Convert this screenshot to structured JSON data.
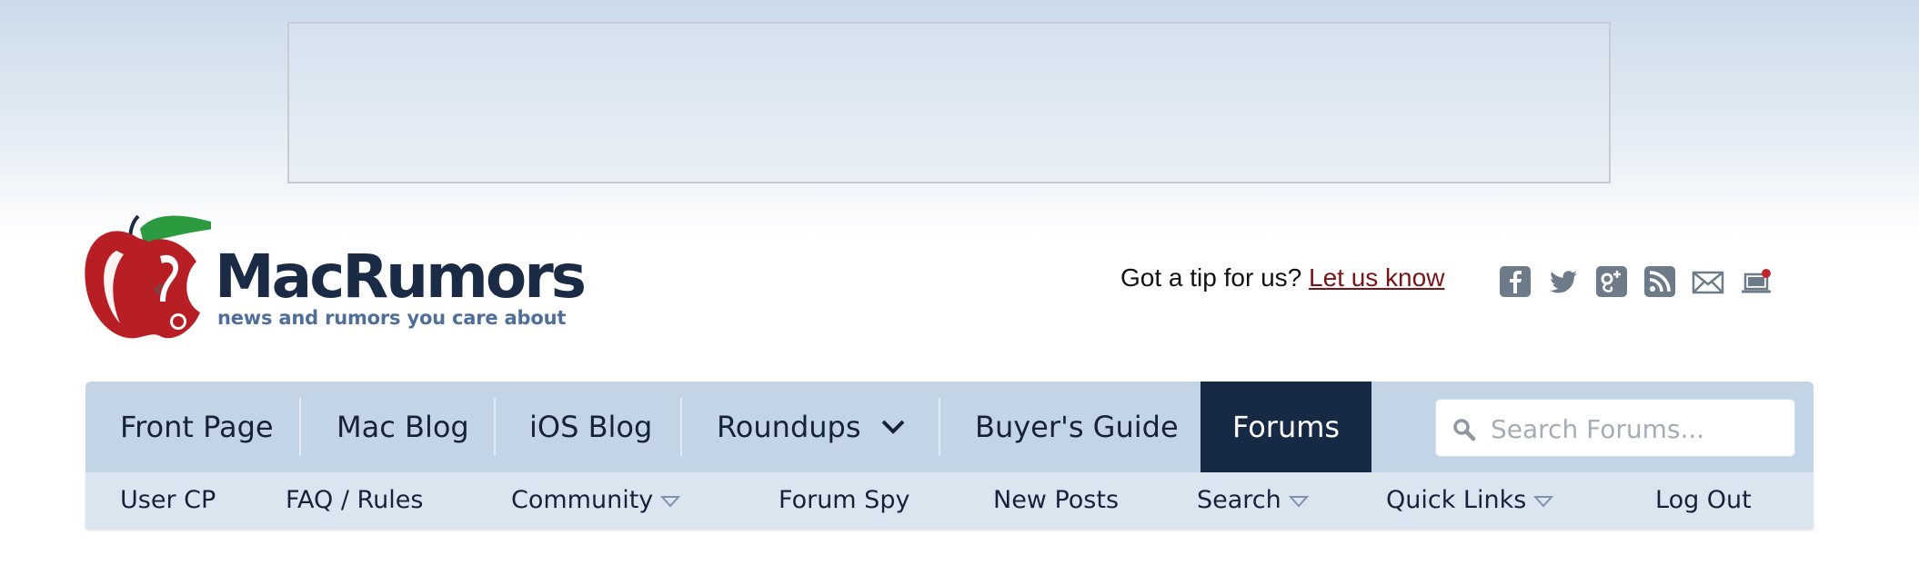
{
  "brand": {
    "name": "MacRumors",
    "tagline": "news and rumors you care about",
    "colors": {
      "apple_red": "#b71f24",
      "leaf_green": "#2c9a3f",
      "navy": "#1b2a45",
      "tagline_blue": "#4f6f9a"
    }
  },
  "tip": {
    "prompt": "Got a tip for us?",
    "link_label": "Let us know"
  },
  "social": [
    "facebook-icon",
    "twitter-icon",
    "google-plus-icon",
    "rss-icon",
    "email-icon",
    "notification-laptop-icon"
  ],
  "nav": {
    "items": [
      "Front Page",
      "Mac Blog",
      "iOS Blog",
      "Roundups",
      "Buyer's Guide",
      "Forums"
    ],
    "active": "Forums",
    "search_placeholder": "Search Forums..."
  },
  "subnav": {
    "items": [
      "User CP",
      "FAQ / Rules",
      "Community",
      "Forum Spy",
      "New Posts",
      "Search",
      "Quick Links",
      "Log Out"
    ]
  },
  "theme": {
    "nav_bg": "#c4d4e7",
    "nav_active_bg": "#172a45",
    "subnav_bg": "#dbe5f0"
  }
}
